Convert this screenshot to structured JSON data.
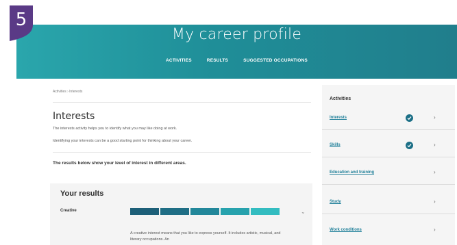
{
  "step_badge": {
    "number": "5",
    "color": "#5a3a86"
  },
  "header": {
    "title": "My career profile",
    "nav": [
      "ACTIVITIES",
      "RESULTS",
      "SUGGESTED OCCUPATIONS"
    ],
    "colors": {
      "start": "#2aa6ac",
      "end": "#207e8c"
    }
  },
  "main": {
    "breadcrumb": "Activities › Interests",
    "title": "Interests",
    "intro": [
      "The interests activity helps you to identify what you may like doing at work.",
      "Identifying your interests can be a good starting point for thinking about your career."
    ],
    "lead": "The results below show your level of interest in different areas.",
    "results": {
      "title": "Your results",
      "category": "Creative",
      "level": 5,
      "max_level": 5,
      "segment_colors": [
        "#1d5f78",
        "#1f6e85",
        "#22879a",
        "#27a2ad",
        "#33bcc0"
      ],
      "description": "A creative interest means that you like to express yourself. It includes artistic, musical, and literary occupations. An"
    }
  },
  "sidebar": {
    "title": "Activities",
    "items": [
      {
        "label": "Interests",
        "completed": true
      },
      {
        "label": "Skills",
        "completed": true
      },
      {
        "label": "Education and training",
        "completed": false
      },
      {
        "label": "Study",
        "completed": false
      },
      {
        "label": "Work conditions",
        "completed": false
      }
    ],
    "icons": {
      "completed": "check-circle-icon",
      "navigate": "chevron-right-icon"
    }
  }
}
